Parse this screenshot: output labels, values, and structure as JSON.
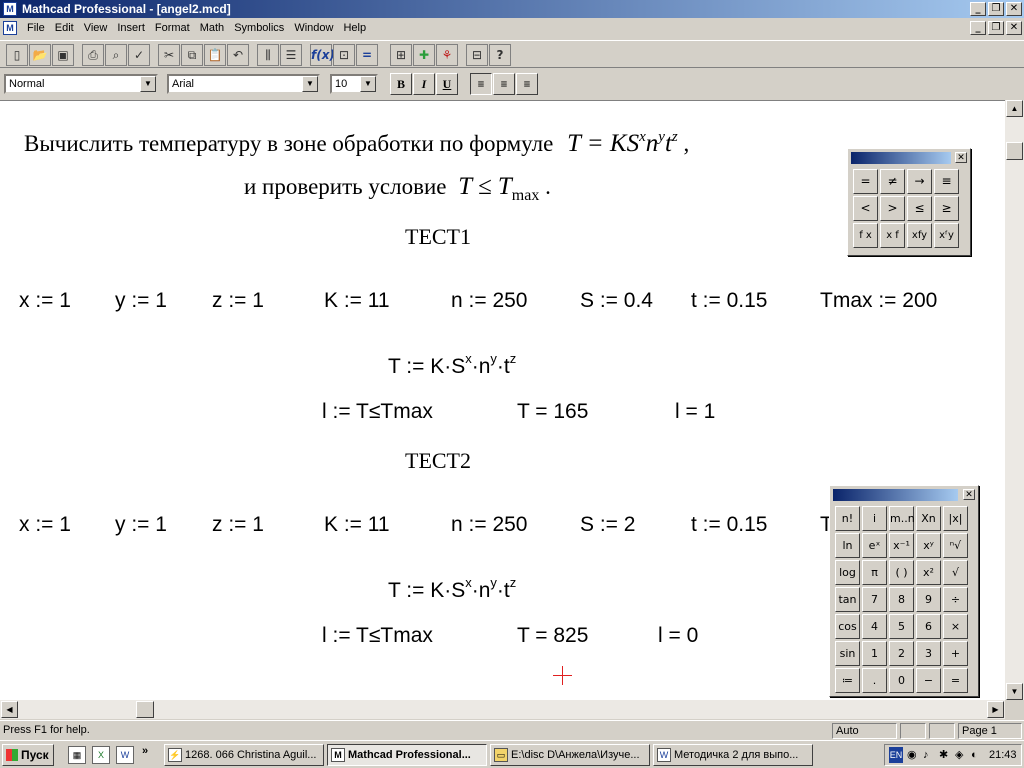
{
  "window": {
    "title": "Mathcad Professional - [angel2.mcd]",
    "app_icon": "mathcad-icon"
  },
  "menu": [
    "File",
    "Edit",
    "View",
    "Insert",
    "Format",
    "Math",
    "Symbolics",
    "Window",
    "Help"
  ],
  "toolbar": {
    "style": "Normal",
    "font": "Arial",
    "size": "10",
    "bold": "B",
    "italic": "I",
    "underline": "U"
  },
  "document": {
    "intro_line1": "Вычислить температуру в зоне обработки по формуле",
    "formula": "T = KS",
    "formula_sup_x": "x",
    "formula_n": "n",
    "formula_sup_y": "y",
    "formula_t": "t",
    "formula_sup_z": "z",
    "formula_comma": ",",
    "intro_line2": "и проверить условие",
    "condition": "T ≤ T",
    "condition_sub": "max",
    "condition_dot": ".",
    "tests": [
      {
        "heading": "ТЕСТ1",
        "vars": [
          "x := 1",
          "y := 1",
          "z := 1",
          "K := 11",
          "n := 250",
          "S := 0.4",
          "t := 0.15",
          "Tmax := 200"
        ],
        "eq_T": "T := K·S",
        "eq_n": "·n",
        "eq_t": "·t",
        "sup_x": "x",
        "sup_y": "y",
        "sup_z": "z",
        "cond": "l := T≤Tmax",
        "result_T": "T = 165",
        "result_l": "l = 1"
      },
      {
        "heading": "ТЕСТ2",
        "vars": [
          "x := 1",
          "y := 1",
          "z := 1",
          "K := 11",
          "n := 250",
          "S := 2",
          "t := 0.15",
          "T"
        ],
        "eq_T": "T := K·S",
        "eq_n": "·n",
        "eq_t": "·t",
        "sup_x": "x",
        "sup_y": "y",
        "sup_z": "z",
        "cond": "l := T≤Tmax",
        "result_T": "T = 825",
        "result_l": "l = 0"
      }
    ]
  },
  "boolean_palette": [
    "=",
    "≠",
    "→",
    "≡",
    "<",
    ">",
    "≤",
    "≥",
    "f x",
    "x f",
    "xfy",
    "xᶠy"
  ],
  "calculator_palette": [
    "n!",
    "i",
    "m..n",
    "Xn",
    "|x|",
    "ln",
    "eˣ",
    "x⁻¹",
    "xʸ",
    "ⁿ√",
    "log",
    "π",
    "( )",
    "x²",
    "√",
    "tan",
    "7",
    "8",
    "9",
    "÷",
    "cos",
    "4",
    "5",
    "6",
    "×",
    "sin",
    "1",
    "2",
    "3",
    "+",
    "≔",
    ".",
    "0",
    "−",
    "="
  ],
  "status": {
    "help": "Press F1 for help.",
    "mode": "Auto",
    "page": "Page 1"
  },
  "taskbar": {
    "start": "Пуск",
    "tasks": [
      "1268. 066 Christina Aguil...",
      "Mathcad Professional...",
      "E:\\disc D\\Анжела\\Изуче...",
      "Методичка 2 для выпо..."
    ],
    "lang": "EN",
    "clock": "21:43"
  }
}
